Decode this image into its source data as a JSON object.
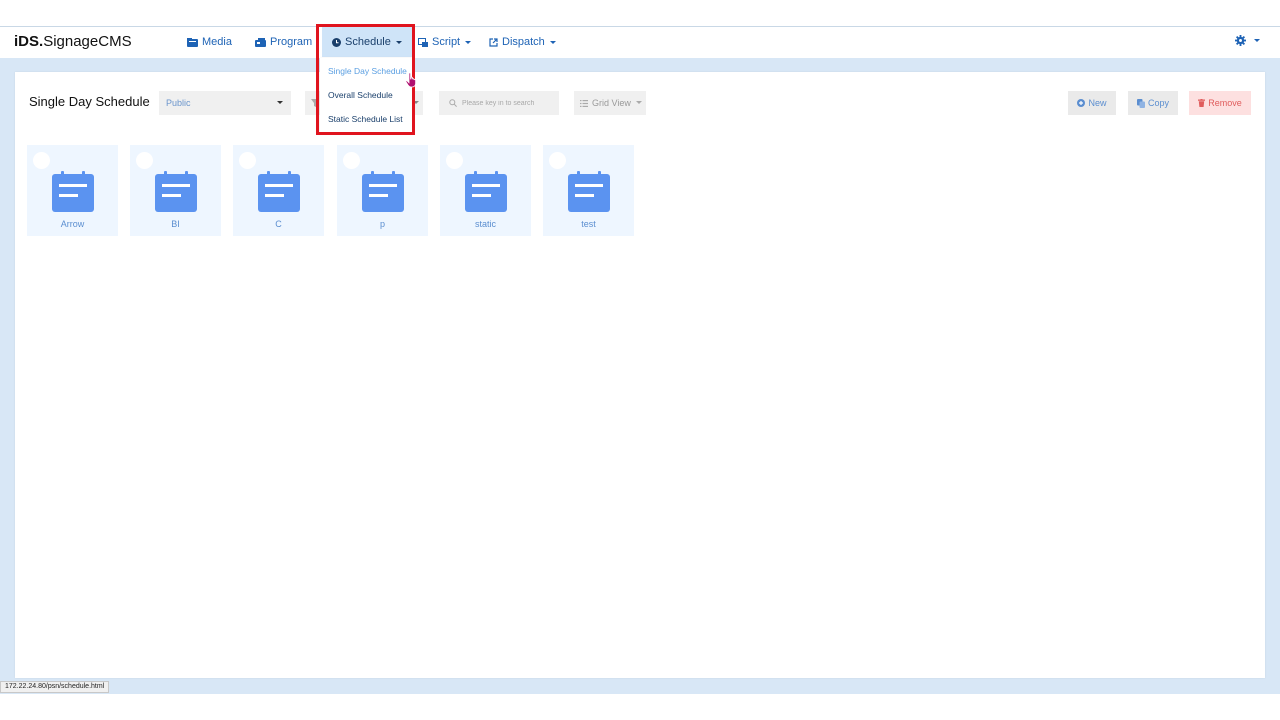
{
  "app": {
    "brand_bold": "iDS.",
    "brand_rest": "SignageCMS"
  },
  "nav": {
    "media": "Media",
    "program": "Program",
    "schedule": "Schedule",
    "script": "Script",
    "dispatch": "Dispatch"
  },
  "dropdown": {
    "items": [
      "Single Day Schedule",
      "Overall Schedule",
      "Static Schedule List"
    ],
    "hovered_index": 0
  },
  "page": {
    "title": "Single Day Schedule"
  },
  "toolbar": {
    "visibility_select": "Public",
    "search_placeholder": "Please key in to search",
    "view_select": "Grid View",
    "new_label": "New",
    "copy_label": "Copy",
    "remove_label": "Remove"
  },
  "schedules": [
    "Arrow",
    "BI",
    "C",
    "p",
    "static",
    "test"
  ],
  "status_url": "172.22.24.80/psn/schedule.html",
  "colors": {
    "accent": "#1e63b5",
    "page_background": "#d8e7f6",
    "card_background": "#eef6ff",
    "calendar_icon": "#5b93f0",
    "remove": "#e05d5d",
    "highlight": "#e0141e"
  }
}
